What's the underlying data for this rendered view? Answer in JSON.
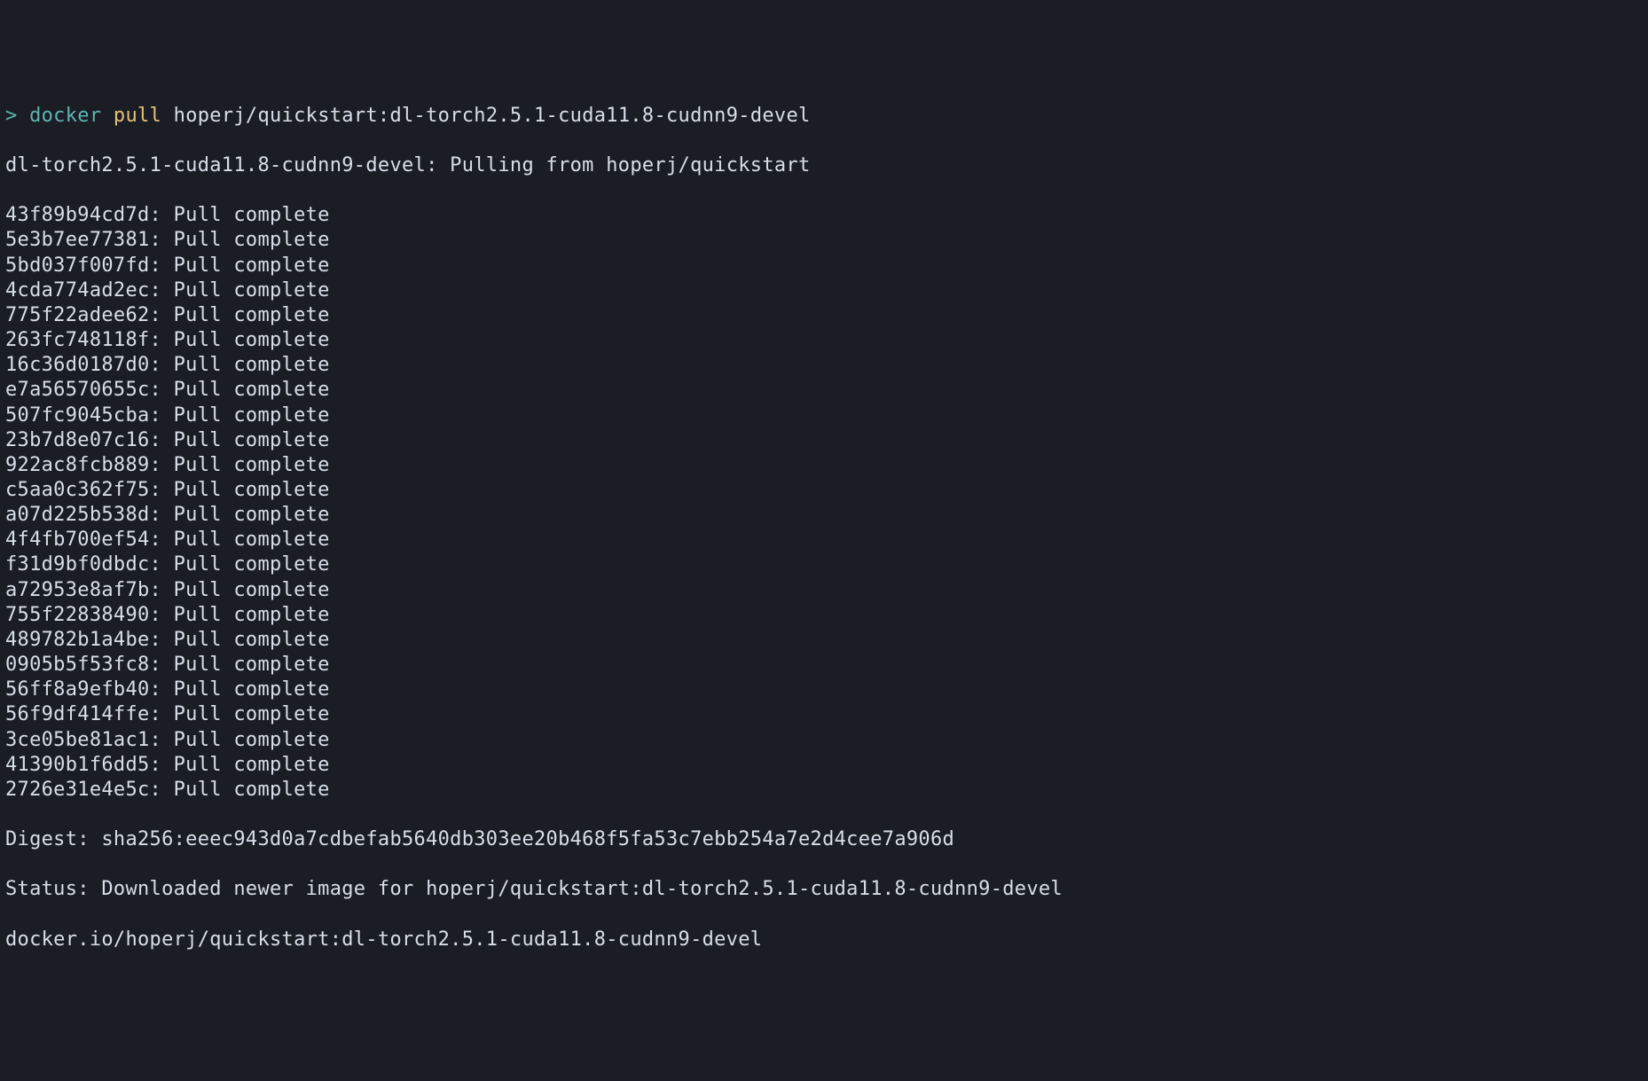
{
  "command": {
    "prompt": "> ",
    "docker": "docker",
    "pull": "pull",
    "image": "hoperj/quickstart:dl-torch2.5.1-cuda11.8-cudnn9-devel"
  },
  "pulling_line": "dl-torch2.5.1-cuda11.8-cudnn9-devel: Pulling from hoperj/quickstart",
  "layers": [
    "43f89b94cd7d: Pull complete",
    "5e3b7ee77381: Pull complete",
    "5bd037f007fd: Pull complete",
    "4cda774ad2ec: Pull complete",
    "775f22adee62: Pull complete",
    "263fc748118f: Pull complete",
    "16c36d0187d0: Pull complete",
    "e7a56570655c: Pull complete",
    "507fc9045cba: Pull complete",
    "23b7d8e07c16: Pull complete",
    "922ac8fcb889: Pull complete",
    "c5aa0c362f75: Pull complete",
    "a07d225b538d: Pull complete",
    "4f4fb700ef54: Pull complete",
    "f31d9bf0dbdc: Pull complete",
    "a72953e8af7b: Pull complete",
    "755f22838490: Pull complete",
    "489782b1a4be: Pull complete",
    "0905b5f53fc8: Pull complete",
    "56ff8a9efb40: Pull complete",
    "56f9df414ffe: Pull complete",
    "3ce05be81ac1: Pull complete",
    "41390b1f6dd5: Pull complete",
    "2726e31e4e5c: Pull complete"
  ],
  "digest": "Digest: sha256:eeec943d0a7cdbefab5640db303ee20b468f5fa53c7ebb254a7e2d4cee7a906d",
  "status": "Status: Downloaded newer image for hoperj/quickstart:dl-torch2.5.1-cuda11.8-cudnn9-devel",
  "final": "docker.io/hoperj/quickstart:dl-torch2.5.1-cuda11.8-cudnn9-devel"
}
